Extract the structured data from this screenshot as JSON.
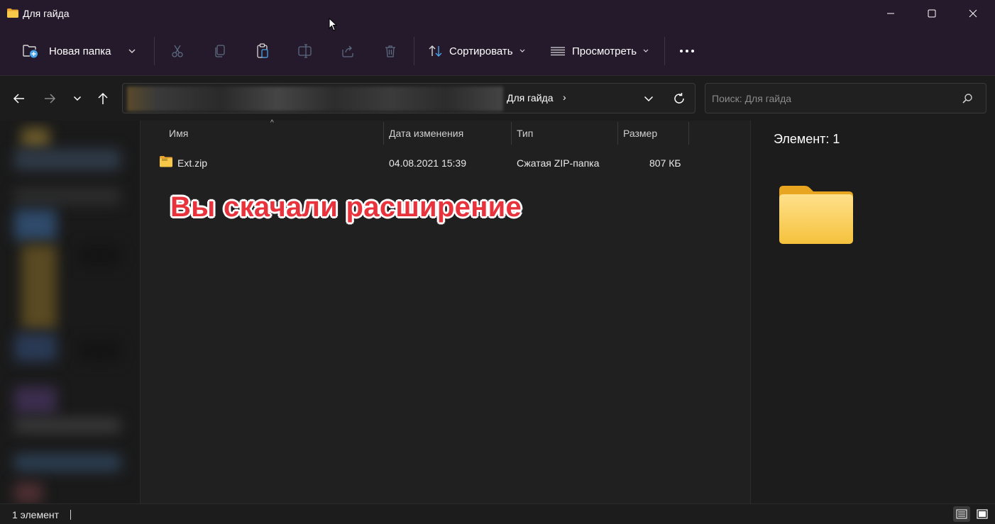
{
  "window": {
    "title": "Для гайда",
    "controls": {
      "minimize_icon": "minimize-icon",
      "maximize_icon": "maximize-icon",
      "close_icon": "close-icon"
    }
  },
  "toolbar": {
    "new_folder_label": "Новая папка",
    "sort_label": "Сортировать",
    "view_label": "Просмотреть",
    "icons": [
      "new-folder-icon",
      "cut-icon",
      "copy-icon",
      "paste-icon",
      "rename-icon",
      "share-icon",
      "delete-icon",
      "sort-icon",
      "view-icon",
      "more-icon"
    ]
  },
  "navigation": {
    "breadcrumb_current": "Для гайда",
    "search_placeholder": "Поиск: Для гайда"
  },
  "columns": {
    "name": "Имя",
    "date": "Дата изменения",
    "type": "Тип",
    "size": "Размер"
  },
  "files": [
    {
      "name": "Ext.zip",
      "date": "04.08.2021 15:39",
      "type": "Сжатая ZIP-папка",
      "size": "807 КБ",
      "icon": "zip-folder-icon"
    }
  ],
  "overlay_caption": "Вы скачали расширение",
  "details_pane": {
    "title": "Элемент: 1",
    "icon": "folder-icon"
  },
  "status": {
    "item_count": "1 элемент"
  },
  "colors": {
    "folder_yellow": "#f8c84a",
    "caption_red": "#e8323c",
    "titlebar_bg": "#241a2b"
  }
}
